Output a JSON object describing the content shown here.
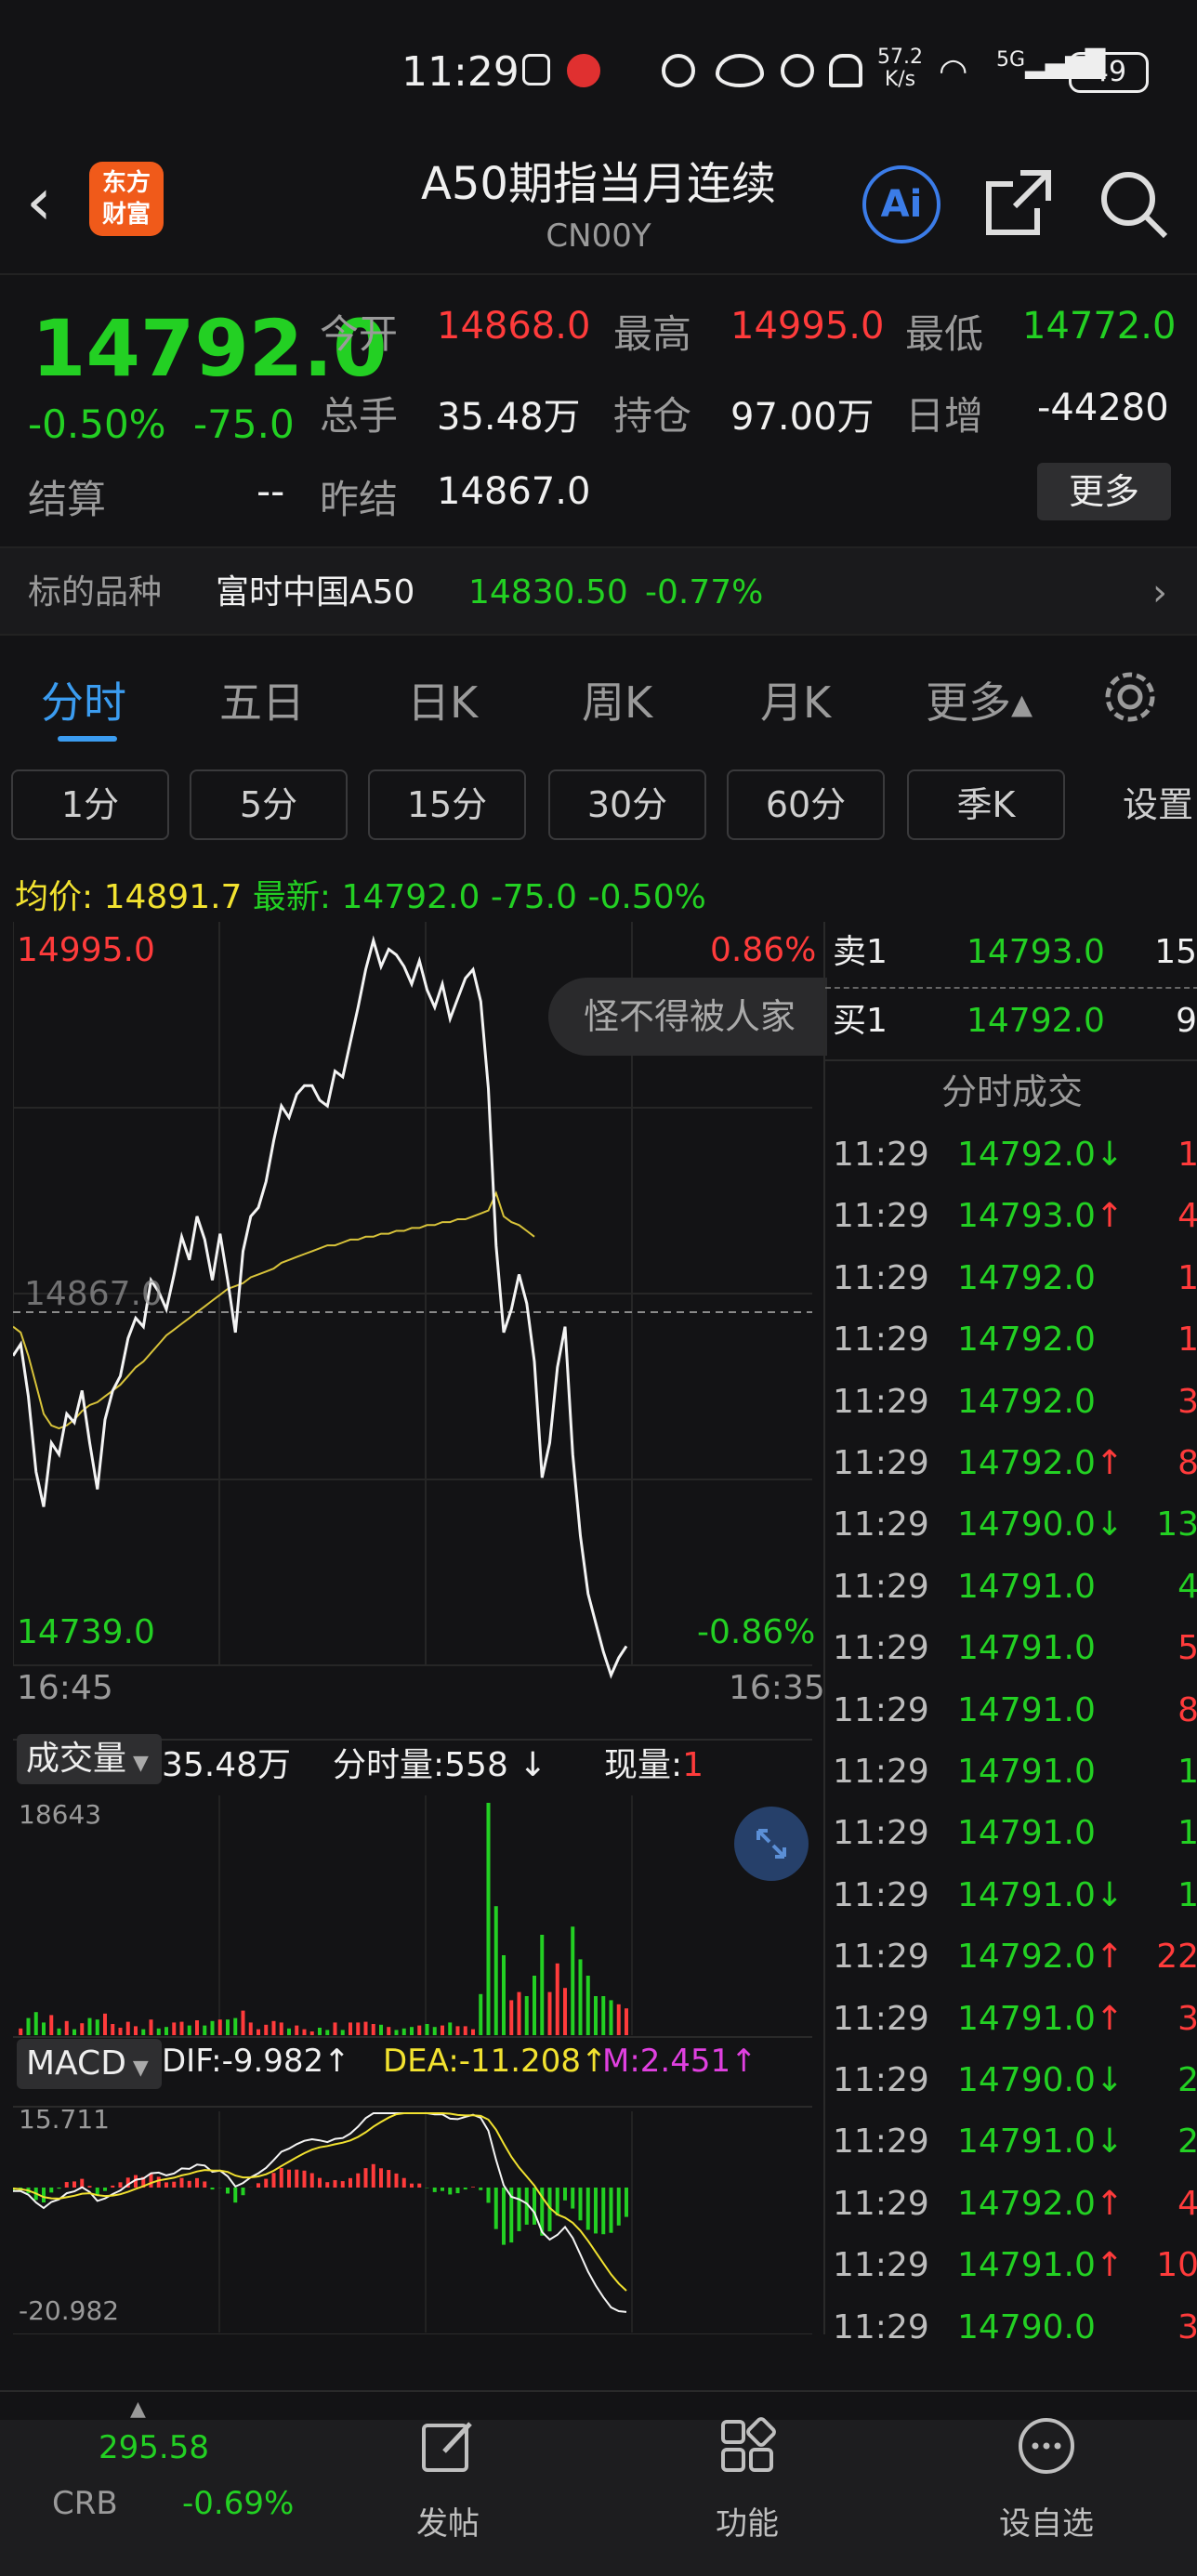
{
  "status_bar": {
    "time": "11:29",
    "net_speed_top": "57.2",
    "net_speed_bottom": "K/s",
    "signal": "5G",
    "battery": "49"
  },
  "header": {
    "logo_top": "东方",
    "logo_bottom": "财富",
    "title": "A50期指当月连续",
    "subtitle": "CN00Y",
    "ai_label": "Ai"
  },
  "quote": {
    "price": "14792.0",
    "change_pct": "-0.50%",
    "change": "-75.0",
    "open_label": "今开",
    "open": "14868.0",
    "high_label": "最高",
    "high": "14995.0",
    "low_label": "最低",
    "low": "14772.0",
    "volume_label": "总手",
    "volume": "35.48万",
    "oi_label": "持仓",
    "oi": "97.00万",
    "oi_change_label": "日增",
    "oi_change": "-44280",
    "settle_label": "结算",
    "settle": "--",
    "prev_settle_label": "昨结",
    "prev_settle": "14867.0",
    "more_label": "更多"
  },
  "underlying": {
    "label": "标的品种",
    "name": "富时中国A50",
    "price": "14830.50",
    "change_pct": "-0.77%"
  },
  "tabs": [
    "分时",
    "五日",
    "日K",
    "周K",
    "月K",
    "更多▴"
  ],
  "periods": [
    "1分",
    "5分",
    "15分",
    "30分",
    "60分",
    "季K",
    "设置"
  ],
  "avg_line": {
    "avg_label": "均价:",
    "avg": "14891.7",
    "latest_label": "最新:",
    "latest": "14792.0",
    "change": "-75.0",
    "change_pct": "-0.50%"
  },
  "chart": {
    "max_price": "14995.0",
    "max_pct": "0.86%",
    "ref_price": "14867.0",
    "min_price": "14739.0",
    "min_pct": "-0.86%",
    "time_start": "16:45",
    "time_end": "16:35",
    "watermark": "怪不得被人家",
    "volume_label": "成交量",
    "volume_value": "35.48万",
    "tick_vol_label": "分时量:558",
    "cur_vol_label": "现量:",
    "cur_vol": "1",
    "vol_max": "18643",
    "macd_label": "MACD",
    "dif": "DIF:-9.982",
    "dea": "DEA:-11.208",
    "m": "M:2.451",
    "macd_max": "15.711",
    "macd_min": "-20.982"
  },
  "chart_data": {
    "type": "line",
    "title": "",
    "ylim": [
      14739.0,
      14995.0
    ],
    "series": [
      {
        "values": [
          14852,
          14856,
          14838,
          14812,
          14800,
          14822,
          14818,
          14832,
          14829,
          14840,
          14822,
          14806,
          14830,
          14840,
          14845,
          14858,
          14865,
          14862,
          14878,
          14874,
          14868,
          14880,
          14893,
          14885,
          14900,
          14892,
          14878,
          14894,
          14878,
          14860,
          14888,
          14900,
          14903,
          14912,
          14926,
          14938,
          14934,
          14942,
          14945,
          14945,
          14940,
          14938,
          14950,
          14948,
          14960,
          14972,
          14985,
          14995,
          14986,
          14992,
          14990,
          14986,
          14980,
          14988,
          14978,
          14972,
          14980,
          14968,
          14975,
          14982,
          14985,
          14974,
          14944,
          14890,
          14860,
          14868,
          14880,
          14870,
          14850,
          14810,
          14822,
          14848,
          14862,
          14818,
          14790,
          14770,
          14760,
          14750,
          14742,
          14748,
          14752
        ]
      },
      {
        "values": [
          14862,
          14860,
          14852,
          14842,
          14832,
          14828,
          14827,
          14828,
          14830,
          14833,
          14835,
          14836,
          14838,
          14840,
          14842,
          14845,
          14848,
          14850,
          14853,
          14856,
          14859,
          14861,
          14863,
          14865,
          14867,
          14869,
          14871,
          14873,
          14875,
          14876,
          14877,
          14879,
          14880,
          14881,
          14882,
          14884,
          14885,
          14886,
          14887,
          14888,
          14889,
          14890,
          14890,
          14891,
          14892,
          14892,
          14893,
          14893,
          14894,
          14894,
          14895,
          14895,
          14896,
          14896,
          14897,
          14897,
          14898,
          14898,
          14899,
          14899,
          14900,
          14901,
          14902,
          14908,
          14900,
          14898,
          14897,
          14895,
          14893
        ]
      }
    ]
  },
  "book": {
    "ask_label": "卖1",
    "ask_price": "14793.0",
    "ask_vol": "15",
    "bid_label": "买1",
    "bid_price": "14792.0",
    "bid_vol": "9",
    "trades_title": "分时成交",
    "trades": [
      {
        "time": "11:29",
        "price": "14792.0",
        "arrow": "↓",
        "vol": "1",
        "volc": "red"
      },
      {
        "time": "11:29",
        "price": "14793.0",
        "arrow": "↑",
        "vol": "4",
        "volc": "red"
      },
      {
        "time": "11:29",
        "price": "14792.0",
        "arrow": "",
        "vol": "1",
        "volc": "red"
      },
      {
        "time": "11:29",
        "price": "14792.0",
        "arrow": "",
        "vol": "1",
        "volc": "red"
      },
      {
        "time": "11:29",
        "price": "14792.0",
        "arrow": "",
        "vol": "3",
        "volc": "red"
      },
      {
        "time": "11:29",
        "price": "14792.0",
        "arrow": "↑",
        "vol": "8",
        "volc": "red"
      },
      {
        "time": "11:29",
        "price": "14790.0",
        "arrow": "↓",
        "vol": "13",
        "volc": "green"
      },
      {
        "time": "11:29",
        "price": "14791.0",
        "arrow": "",
        "vol": "4",
        "volc": "green"
      },
      {
        "time": "11:29",
        "price": "14791.0",
        "arrow": "",
        "vol": "5",
        "volc": "red"
      },
      {
        "time": "11:29",
        "price": "14791.0",
        "arrow": "",
        "vol": "8",
        "volc": "red"
      },
      {
        "time": "11:29",
        "price": "14791.0",
        "arrow": "",
        "vol": "1",
        "volc": "green"
      },
      {
        "time": "11:29",
        "price": "14791.0",
        "arrow": "",
        "vol": "1",
        "volc": "green"
      },
      {
        "time": "11:29",
        "price": "14791.0",
        "arrow": "↓",
        "vol": "1",
        "volc": "green"
      },
      {
        "time": "11:29",
        "price": "14792.0",
        "arrow": "↑",
        "vol": "22",
        "volc": "red"
      },
      {
        "time": "11:29",
        "price": "14791.0",
        "arrow": "↑",
        "vol": "3",
        "volc": "red"
      },
      {
        "time": "11:29",
        "price": "14790.0",
        "arrow": "↓",
        "vol": "2",
        "volc": "green"
      },
      {
        "time": "11:29",
        "price": "14791.0",
        "arrow": "↓",
        "vol": "2",
        "volc": "green"
      },
      {
        "time": "11:29",
        "price": "14792.0",
        "arrow": "↑",
        "vol": "4",
        "volc": "red"
      },
      {
        "time": "11:29",
        "price": "14791.0",
        "arrow": "↑",
        "vol": "10",
        "volc": "red"
      },
      {
        "time": "11:29",
        "price": "14790.0",
        "arrow": "",
        "vol": "3",
        "volc": "red"
      }
    ]
  },
  "bottom_nav": {
    "crb_value": "295.58",
    "crb_label": "CRB",
    "crb_change": "-0.69%",
    "post": "发帖",
    "functions": "功能",
    "watchlist": "设自选"
  },
  "colors": {
    "up": "#ff3b3b",
    "down": "#23d023",
    "accent": "#3b9cf0",
    "avg": "#f2e230"
  }
}
